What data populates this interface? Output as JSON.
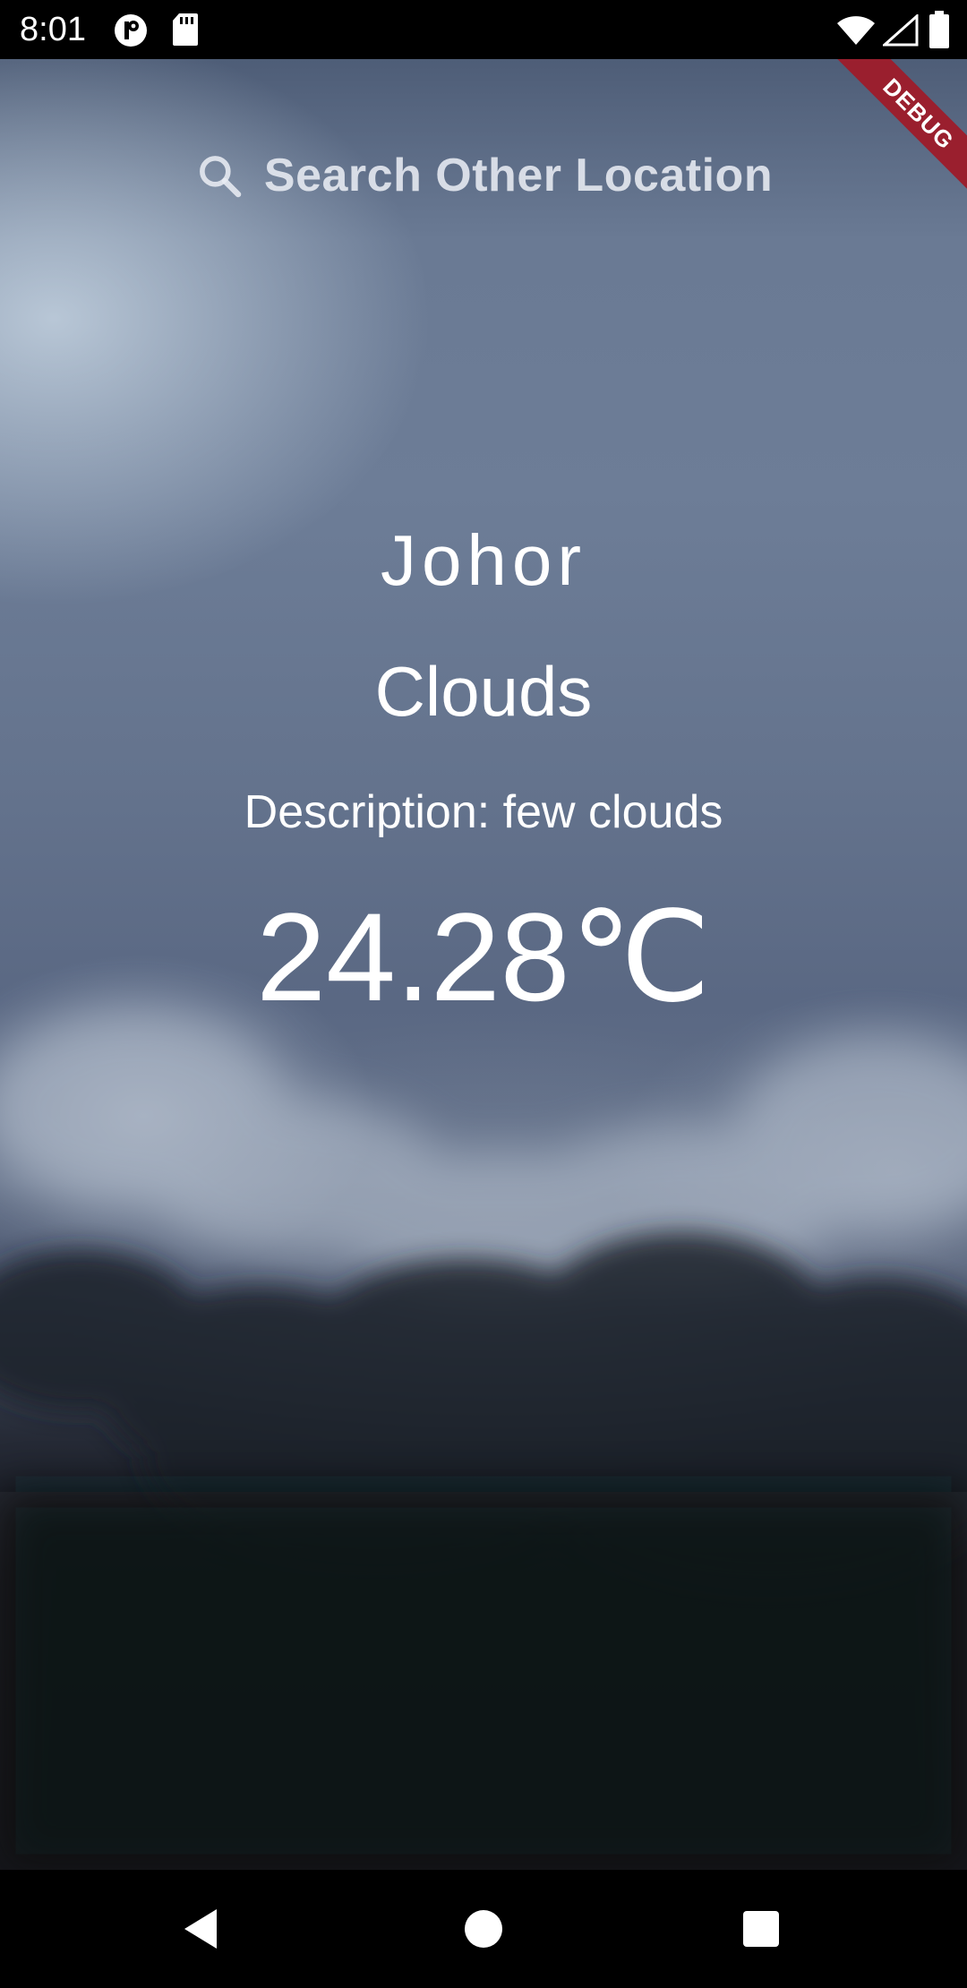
{
  "status_bar": {
    "time": "8:01",
    "icons": [
      "notification-p-icon",
      "sd-card-icon",
      "wifi-icon",
      "signal-icon",
      "battery-icon"
    ]
  },
  "debug_banner": {
    "label": "DEBUG",
    "color": "#9a1f2e"
  },
  "search": {
    "label": "Search Other Location",
    "icon": "search-icon"
  },
  "weather": {
    "city": "Johor",
    "main": "Clouds",
    "description": "Description: few clouds",
    "temperature": "24.28℃"
  },
  "nav_bar": {
    "buttons": [
      "back-icon",
      "home-icon",
      "recents-icon"
    ]
  }
}
